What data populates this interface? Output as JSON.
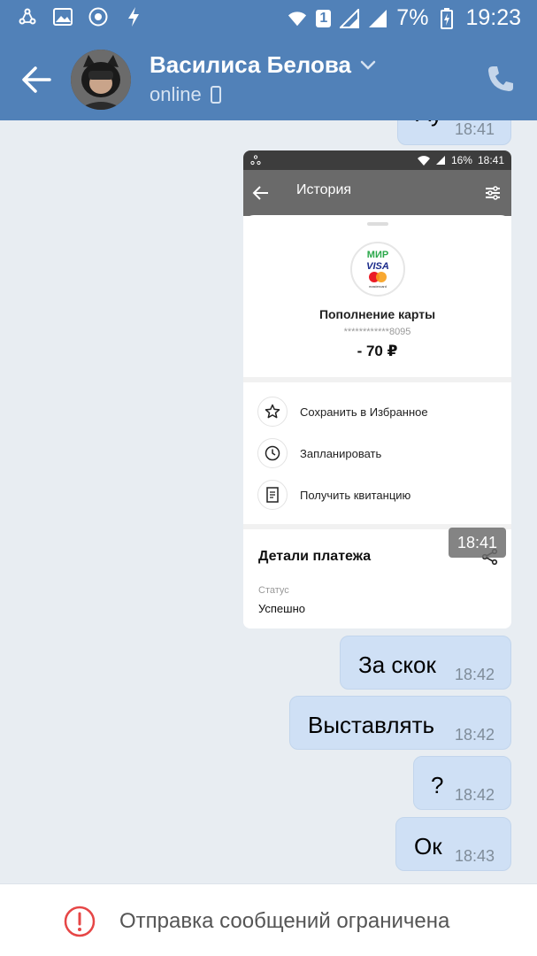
{
  "status_bar": {
    "battery": "7%",
    "time": "19:23",
    "sim": "1"
  },
  "header": {
    "name": "Василиса Белова",
    "presence": "online"
  },
  "messages": {
    "top_partial": {
      "text": "Ау",
      "time": "18:41"
    },
    "screenshot": {
      "status_time": "18:41",
      "status_battery": "16%",
      "title": "История",
      "payment_title": "Пополнение карты",
      "card_number": "************8095",
      "amount": "- 70 ₽",
      "logo_mir": "МИР",
      "logo_visa": "VISA",
      "logo_mc": "mastercard",
      "actions": [
        "Сохранить в Избранное",
        "Запланировать",
        "Получить квитанцию"
      ],
      "details_title": "Детали платежа",
      "status_label": "Статус",
      "status_value": "Успешно",
      "time": "18:41"
    },
    "list": [
      {
        "text": "За скок",
        "time": "18:42"
      },
      {
        "text": "Выставлять",
        "time": "18:42"
      },
      {
        "text": "?",
        "time": "18:42"
      },
      {
        "text": "Ок",
        "time": "18:43"
      }
    ]
  },
  "bottom": {
    "restriction": "Отправка сообщений ограничена"
  },
  "colors": {
    "header": "#5181b8",
    "bubble": "#cfe0f5",
    "background": "#e8edf2",
    "warning": "#e64646"
  }
}
